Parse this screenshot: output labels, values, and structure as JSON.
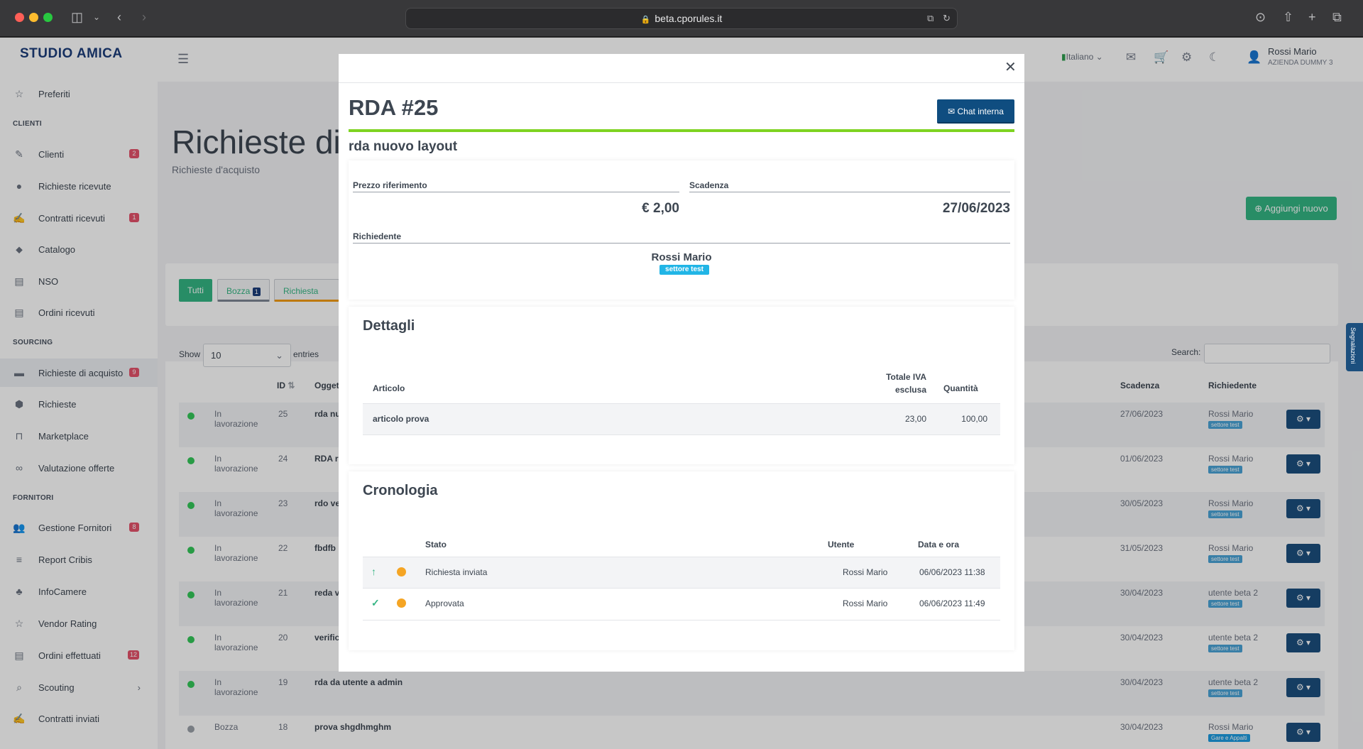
{
  "browser": {
    "url": "beta.cporules.it"
  },
  "app": {
    "brand": "STUDIO AMICA",
    "sidebar": {
      "items": [
        {
          "label": "Preferiti",
          "icon": "star-icon"
        },
        {
          "section": "CLIENTI"
        },
        {
          "label": "Clienti",
          "icon": "brush-icon",
          "badge": "2"
        },
        {
          "label": "Richieste ricevute",
          "icon": "circle-icon"
        },
        {
          "label": "Contratti ricevuti",
          "icon": "signature-icon",
          "badge": "1"
        },
        {
          "label": "Catalogo",
          "icon": "tag-icon"
        },
        {
          "label": "NSO",
          "icon": "list-icon"
        },
        {
          "label": "Ordini ricevuti",
          "icon": "document-icon"
        },
        {
          "section": "SOURCING"
        },
        {
          "label": "Richieste di acquisto",
          "icon": "card-icon",
          "badge": "9"
        },
        {
          "label": "Richieste",
          "icon": "cube-icon"
        },
        {
          "label": "Marketplace",
          "icon": "shopping-bag-icon"
        },
        {
          "label": "Valutazione offerte",
          "icon": "glasses-icon"
        },
        {
          "section": "FORNITORI"
        },
        {
          "label": "Gestione Fornitori",
          "icon": "users-icon",
          "badge": "8"
        },
        {
          "label": "Report Cribis",
          "icon": "cribis-logo-icon"
        },
        {
          "label": "InfoCamere",
          "icon": "tree-icon"
        },
        {
          "label": "Vendor Rating",
          "icon": "star-icon"
        },
        {
          "label": "Ordini effettuati",
          "icon": "list-icon",
          "badge": "12"
        },
        {
          "label": "Scouting",
          "icon": "search-icon"
        },
        {
          "label": "Contratti inviati",
          "icon": "signature-icon"
        }
      ]
    },
    "topbar": {
      "language": "Italiano",
      "user_name": "Rossi Mario",
      "company": "AZIENDA DUMMY 3"
    },
    "page": {
      "title": "Richieste di",
      "subtitle": "Richieste d'acquisto",
      "add_button": "Aggiungi nuovo",
      "filters": {
        "all": "Tutti",
        "bozza": "Bozza",
        "bozza_count": "1",
        "inviata": "Richiesta inviata"
      },
      "table": {
        "show_label": "Show",
        "page_size": "10",
        "entries_label": "entries",
        "search_label": "Search:",
        "headers": {
          "id": "ID",
          "oggetto": "Oggetto",
          "scadenza": "Scadenza",
          "richiedente": "Richiedente"
        },
        "rows": [
          {
            "status": "In lavorazione",
            "id": "25",
            "oggetto": "rda nu",
            "scadenza": "27/06/2023",
            "richiedente": "Rossi Mario",
            "tag": "settore test"
          },
          {
            "status": "In lavorazione",
            "id": "24",
            "oggetto": "RDA r",
            "scadenza": "01/06/2023",
            "richiedente": "Rossi Mario",
            "tag": "settore test"
          },
          {
            "status": "In lavorazione",
            "id": "23",
            "oggetto": "rdo ve",
            "scadenza": "30/05/2023",
            "richiedente": "Rossi Mario",
            "tag": "settore test"
          },
          {
            "status": "In lavorazione",
            "id": "22",
            "oggetto": "fbdfb",
            "scadenza": "31/05/2023",
            "richiedente": "Rossi Mario",
            "tag": "settore test"
          },
          {
            "status": "In lavorazione",
            "id": "21",
            "oggetto": "reda v",
            "scadenza": "30/04/2023",
            "richiedente": "utente beta 2",
            "tag": "settore test"
          },
          {
            "status": "In lavorazione",
            "id": "20",
            "oggetto": "verific",
            "scadenza": "30/04/2023",
            "richiedente": "utente beta 2",
            "tag": "settore test"
          },
          {
            "status": "In lavorazione",
            "id": "19",
            "oggetto": "rda da utente a admin",
            "scadenza": "30/04/2023",
            "richiedente": "utente beta 2",
            "tag": "settore test"
          },
          {
            "status": "Bozza",
            "id": "18",
            "oggetto": "prova shgdhmghm",
            "scadenza": "30/04/2023",
            "richiedente": "Rossi Mario",
            "tag": "Gare e Appalti"
          }
        ]
      },
      "segnalazioni_tab": "Segnalazioni"
    }
  },
  "modal": {
    "title": "RDA #25",
    "chat_button": "Chat interna",
    "subtitle": "rda nuovo layout",
    "fields": {
      "prezzo_label": "Prezzo riferimento",
      "prezzo_value": "€ 2,00",
      "scadenza_label": "Scadenza",
      "scadenza_value": "27/06/2023",
      "richiedente_label": "Richiedente",
      "richiedente_name": "Rossi Mario",
      "richiedente_tag": "settore test"
    },
    "dettagli": {
      "title": "Dettagli",
      "headers": {
        "articolo": "Articolo",
        "totale_line1": "Totale IVA",
        "totale_line2": "esclusa",
        "quantita": "Quantità"
      },
      "rows": [
        {
          "articolo": "articolo prova",
          "totale": "23,00",
          "quantita": "100,00"
        }
      ]
    },
    "cronologia": {
      "title": "Cronologia",
      "headers": {
        "stato": "Stato",
        "utente": "Utente",
        "data": "Data e ora"
      },
      "rows": [
        {
          "icon": "arrow-up-icon",
          "stato": "Richiesta inviata",
          "utente": "Rossi Mario",
          "data": "06/06/2023 11:38"
        },
        {
          "icon": "check-icon",
          "stato": "Approvata",
          "utente": "Rossi Mario",
          "data": "06/06/2023 11:49"
        }
      ]
    }
  }
}
